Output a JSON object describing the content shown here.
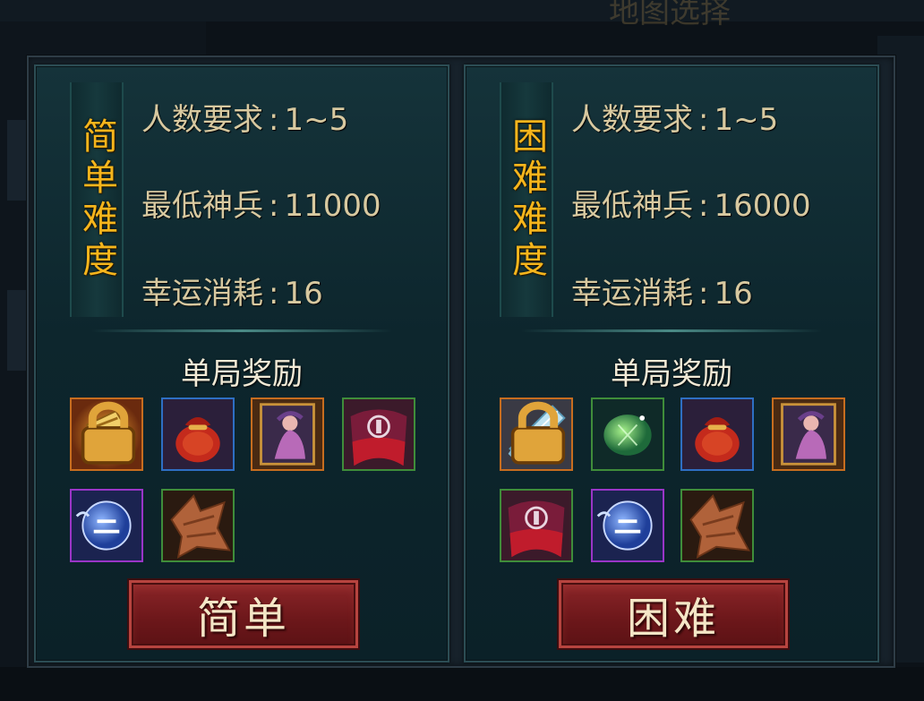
{
  "background": {
    "ghost_title": "地图选择"
  },
  "cards": [
    {
      "difficulty_label": "简单难度",
      "stats": [
        {
          "label": "人数要求",
          "value": "1~5"
        },
        {
          "label": "最低神兵",
          "value": "11000"
        },
        {
          "label": "幸运消耗",
          "value": "16"
        }
      ],
      "reward_title": "单局奖励",
      "rewards": [
        {
          "icon": "golden-scroll-icon",
          "rarity": "orange",
          "locked": true
        },
        {
          "icon": "red-pouch-icon",
          "rarity": "blue",
          "locked": false
        },
        {
          "icon": "hero-card-icon",
          "rarity": "orange",
          "locked": false
        },
        {
          "icon": "red-banner-icon",
          "rarity": "green",
          "locked": false
        },
        {
          "icon": "blue-orb-icon",
          "rarity": "purple",
          "locked": false
        },
        {
          "icon": "wood-fragment-icon",
          "rarity": "green",
          "locked": false
        }
      ],
      "button_label": "简单"
    },
    {
      "difficulty_label": "困难难度",
      "stats": [
        {
          "label": "人数要求",
          "value": "1~5"
        },
        {
          "label": "最低神兵",
          "value": "16000"
        },
        {
          "label": "幸运消耗",
          "value": "16"
        }
      ],
      "reward_title": "单局奖励",
      "rewards": [
        {
          "icon": "ice-sword-icon",
          "rarity": "orange",
          "locked": true
        },
        {
          "icon": "green-gem-icon",
          "rarity": "green",
          "locked": false
        },
        {
          "icon": "red-pouch-icon",
          "rarity": "blue",
          "locked": false
        },
        {
          "icon": "hero-card-icon",
          "rarity": "orange",
          "locked": false
        },
        {
          "icon": "red-banner-icon",
          "rarity": "green",
          "locked": false
        },
        {
          "icon": "blue-orb-icon",
          "rarity": "purple",
          "locked": false
        },
        {
          "icon": "wood-fragment-icon",
          "rarity": "green",
          "locked": false
        }
      ],
      "button_label": "困难"
    }
  ],
  "colors": {
    "difficulty_text": "#f5b51c",
    "stat_text": "#d8c9a0",
    "button_bg": "#7a1d20",
    "rarity_orange": "#c76d1f",
    "rarity_blue": "#2e6fc3",
    "rarity_purple": "#9a35c7",
    "rarity_green": "#3f8d3a"
  }
}
